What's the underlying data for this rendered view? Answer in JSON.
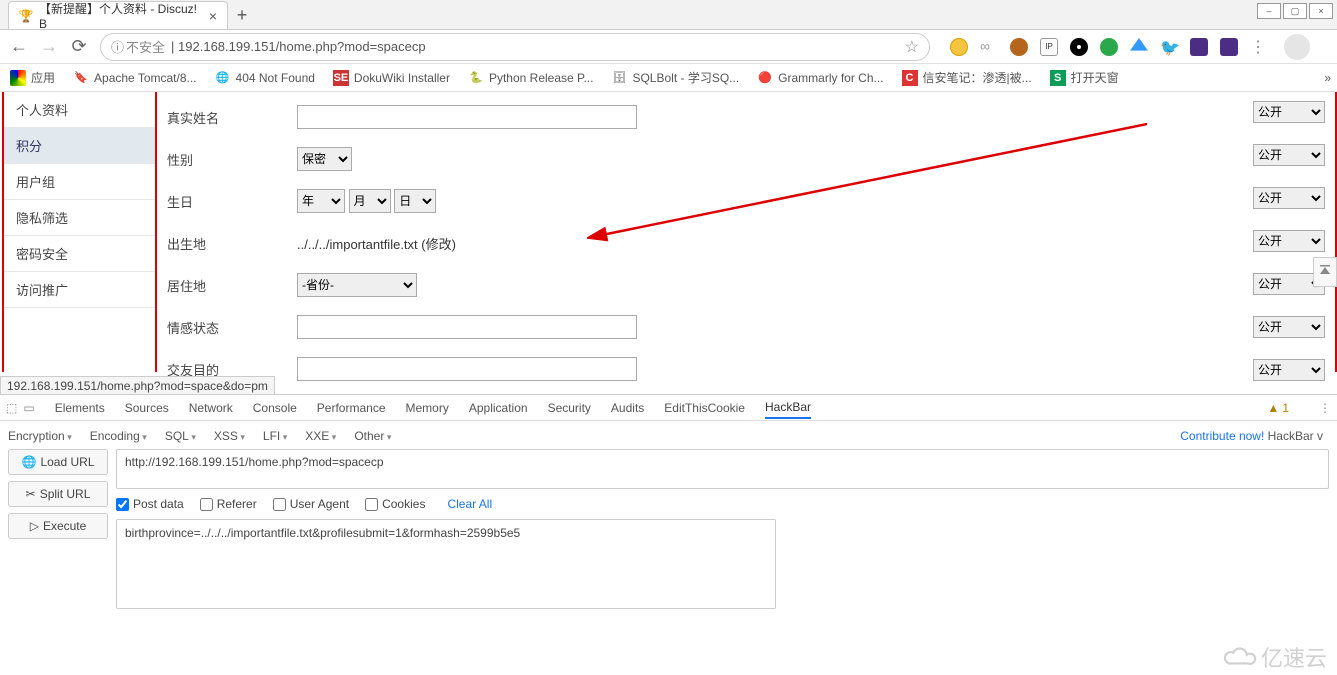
{
  "browser": {
    "tab_title": "【新提醒】个人资料 - Discuz! B",
    "url_insecure_label": "不安全",
    "url_path": "192.168.199.151/home.php?mod=spacecp",
    "bookmarks_label": "应用",
    "bookmarks": [
      "Apache Tomcat/8...",
      "404 Not Found",
      "DokuWiki Installer",
      "Python Release P...",
      "SQLBolt - 学习SQ...",
      "Grammarly for Ch...",
      "信安笔记：渗透|被...",
      "打开天窗"
    ],
    "status_link": "192.168.199.151/home.php?mod=space&do=pm"
  },
  "sidebar": {
    "title": "个人资料",
    "items": [
      "积分",
      "用户组",
      "隐私筛选",
      "密码安全",
      "访问推广"
    ]
  },
  "form": {
    "rows": [
      {
        "label": "真实姓名"
      },
      {
        "label": "性别",
        "gender_value": "保密"
      },
      {
        "label": "生日",
        "year": "年",
        "month": "月",
        "day": "日"
      },
      {
        "label": "出生地",
        "value": "../../../importantfile.txt",
        "modify": "(修改)"
      },
      {
        "label": "居住地",
        "province": "-省份-"
      },
      {
        "label": "情感状态"
      },
      {
        "label": "交友目的"
      }
    ],
    "visibility_option": "公开"
  },
  "devtools": {
    "tabs": [
      "Elements",
      "Sources",
      "Network",
      "Console",
      "Performance",
      "Memory",
      "Application",
      "Security",
      "Audits",
      "EditThisCookie",
      "HackBar"
    ],
    "active_tab": "HackBar",
    "warn_count": "1",
    "hackbar": {
      "menus": [
        "Encryption",
        "Encoding",
        "SQL",
        "XSS",
        "LFI",
        "XXE",
        "Other"
      ],
      "contribute": "Contribute now!",
      "brand": "HackBar v",
      "buttons": {
        "load": "Load URL",
        "split": "Split URL",
        "execute": "Execute"
      },
      "url_value": "http://192.168.199.151/home.php?mod=spacecp",
      "checks": {
        "post": "Post data",
        "referer": "Referer",
        "useragent": "User Agent",
        "cookies": "Cookies"
      },
      "clear": "Clear All",
      "post_body": "birthprovince=../../../importantfile.txt&profilesubmit=1&formhash=2599b5e5"
    }
  },
  "watermark": "亿速云"
}
